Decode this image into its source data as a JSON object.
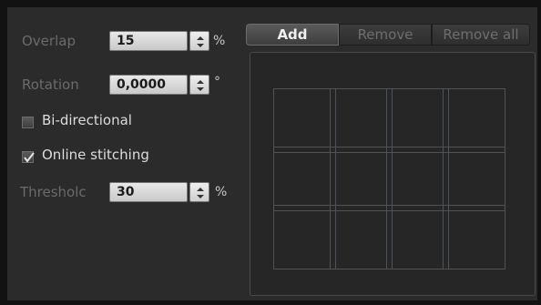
{
  "settings": {
    "overlap": {
      "label": "Overlap",
      "value": "15",
      "unit": "%"
    },
    "rotation": {
      "label": "Rotation",
      "value": "0,0000",
      "unit": "°"
    },
    "bidirectional": {
      "label": "Bi-directional",
      "checked": false
    },
    "online_stitching": {
      "label": "Online stitching",
      "checked": true
    },
    "threshold": {
      "label": "Thresholc",
      "value": "30",
      "unit": "%"
    }
  },
  "tile_buttons": {
    "add": "Add",
    "remove": "Remove",
    "remove_all": "Remove all"
  },
  "tile_grid": {
    "columns": 4,
    "rows": 3
  },
  "colors": {
    "panel_bg": "#2b2b2b",
    "grid_line": "#4f5358",
    "active_text": "#f0f0f0"
  }
}
